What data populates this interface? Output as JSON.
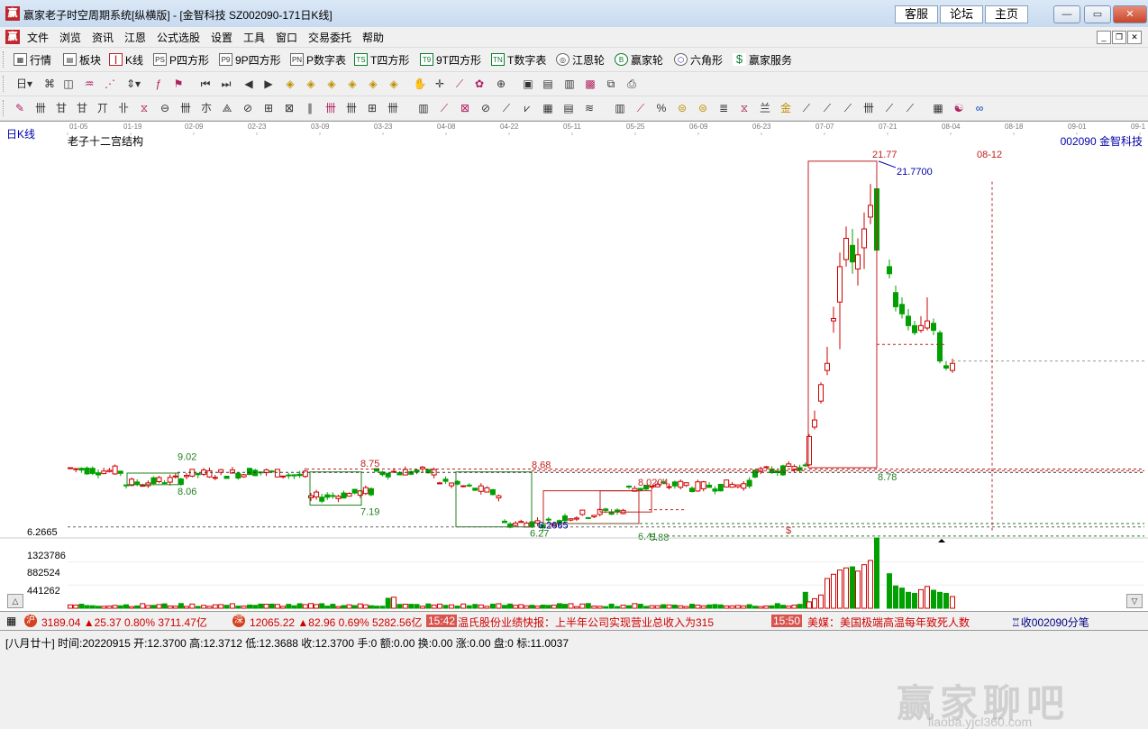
{
  "window": {
    "title": "赢家老子时空周期系统[纵横版] - [金智科技  SZ002090-171日K线]",
    "links": [
      "客服",
      "论坛",
      "主页"
    ]
  },
  "menu": [
    "文件",
    "浏览",
    "资讯",
    "江恩",
    "公式选股",
    "设置",
    "工具",
    "窗口",
    "交易委托",
    "帮助"
  ],
  "toolbar1": [
    {
      "label": "行情",
      "icon": "grid-icon"
    },
    {
      "label": "板块",
      "icon": "blocks-icon"
    },
    {
      "label": "K线",
      "icon": "candles-icon"
    },
    {
      "label": "P四方形",
      "icon": "PS"
    },
    {
      "label": "9P四方形",
      "icon": "P9"
    },
    {
      "label": "P数字表",
      "icon": "PN"
    },
    {
      "label": "T四方形",
      "icon": "TS"
    },
    {
      "label": "9T四方形",
      "icon": "T9"
    },
    {
      "label": "T数字表",
      "icon": "TN"
    },
    {
      "label": "江恩轮",
      "icon": "wheel-icon"
    },
    {
      "label": "赢家轮",
      "icon": "big-icon"
    },
    {
      "label": "六角形",
      "icon": "hexagon-icon"
    },
    {
      "label": "赢家服务",
      "icon": "dollar-icon"
    }
  ],
  "chart_header": {
    "period_label": "日K线",
    "structure": "老子十二宫结构",
    "code": "002090",
    "name": "金智科技"
  },
  "dates": [
    "01-05",
    "01-19",
    "02-09",
    "02-23",
    "03-09",
    "03-23",
    "04-08",
    "04-22",
    "05-11",
    "05-25",
    "06-09",
    "06-23",
    "07-07",
    "07-21",
    "08-04",
    "08-18",
    "09-01",
    "09-1"
  ],
  "price_labels": {
    "high": "21.77",
    "high_exact": "21.7700",
    "future_date": "08-12",
    "l902": "9.02",
    "l806": "8.06",
    "l875": "8.75",
    "l719": "7.19",
    "l868": "8.68",
    "l804": "8.0204",
    "l627": "6.27",
    "l62665": "6.2665",
    "l588": "5.88",
    "l641": "6.41",
    "l878": "8.78",
    "axis_low": "6.2665"
  },
  "volume_axis": [
    "1323786",
    "882524",
    "441262"
  ],
  "chart_data": {
    "type": "candlestick",
    "price_series": [
      {
        "x": "01-05",
        "o": 8.95,
        "c": 8.75,
        "h": 9.0,
        "l": 8.7
      },
      {
        "x": "01-19",
        "o": 8.6,
        "c": 8.1,
        "h": 9.02,
        "l": 8.06
      },
      {
        "x": "02-09",
        "o": 8.3,
        "c": 8.5,
        "h": 8.6,
        "l": 8.2
      },
      {
        "x": "02-23",
        "o": 8.55,
        "c": 8.65,
        "h": 8.75,
        "l": 8.45
      },
      {
        "x": "03-09",
        "o": 8.4,
        "c": 7.5,
        "h": 8.6,
        "l": 7.19
      },
      {
        "x": "03-23",
        "o": 7.8,
        "c": 8.6,
        "h": 8.75,
        "l": 7.7
      },
      {
        "x": "04-08",
        "o": 8.6,
        "c": 8.2,
        "h": 8.68,
        "l": 8.1
      },
      {
        "x": "04-22",
        "o": 7.6,
        "c": 6.4,
        "h": 7.8,
        "l": 6.27
      },
      {
        "x": "05-11",
        "o": 6.5,
        "c": 6.7,
        "h": 6.8,
        "l": 6.41
      },
      {
        "x": "05-25",
        "o": 7.0,
        "c": 7.9,
        "h": 8.0204,
        "l": 6.9
      },
      {
        "x": "06-09",
        "o": 8.1,
        "c": 7.95,
        "h": 8.2,
        "l": 7.9
      },
      {
        "x": "06-23",
        "o": 8.1,
        "c": 8.6,
        "h": 8.7,
        "l": 8.0
      },
      {
        "x": "07-07",
        "o": 8.8,
        "c": 17.0,
        "h": 17.5,
        "l": 8.78
      },
      {
        "x": "07-21",
        "o": 20.5,
        "c": 14.0,
        "h": 21.77,
        "l": 13.8
      },
      {
        "x": "08-04",
        "o": 13.0,
        "c": 11.0,
        "h": 13.5,
        "l": 10.8
      }
    ],
    "ylim": [
      5.8,
      22.3
    ],
    "volume_ylim": [
      0,
      1323786
    ]
  },
  "ticker": {
    "sh_index": "3189.04",
    "sh_change": "▲25.37",
    "sh_pct": "0.80%",
    "sh_amount": "3711.47亿",
    "sz_index": "12065.22",
    "sz_change": "▲82.96",
    "sz_pct": "0.69%",
    "sz_amount": "5282.56亿",
    "news1_time": "15:42",
    "news1": "温氏股份业绩快报：上半年公司实现营业总收入为315",
    "news2_time": "15:50",
    "news2": "美媒：美国极端高温每年致死人数",
    "tick_label": "收002090分笔"
  },
  "status": {
    "lunar": "[八月廿十]",
    "time": "时间:20220915",
    "open": "开:12.3700",
    "high": "高:12.3712",
    "low": "低:12.3688",
    "close": "收:12.3700",
    "hand": "手:0",
    "amount": "额:0.00",
    "turnover": "换:0.00",
    "rise": "涨:0.00",
    "disk": "盘:0",
    "mark": "标:11.0037"
  },
  "watermark": "赢家聊吧",
  "watermark_url": "liaoba.yjcl360.com"
}
